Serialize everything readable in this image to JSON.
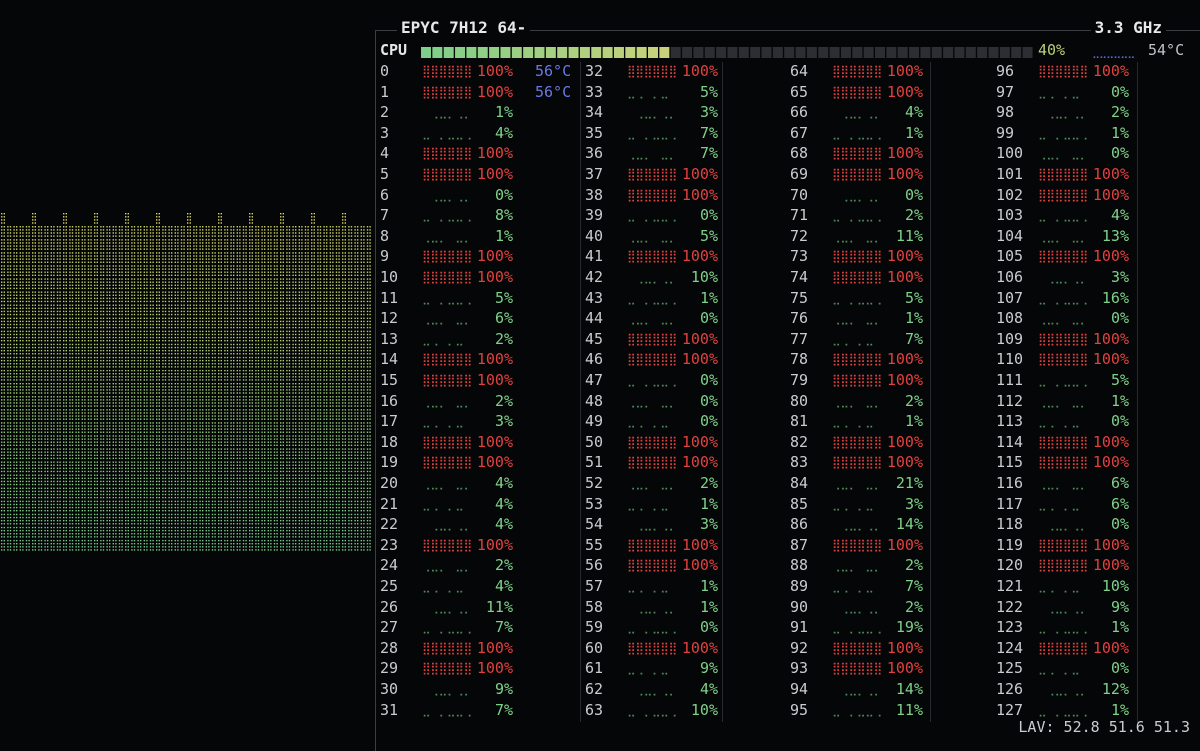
{
  "header": {
    "title": "EPYC 7H12 64-",
    "freq": "3.3 GHz"
  },
  "cpu_total": {
    "label": "CPU",
    "percent": "40%",
    "temp": "54°C",
    "usage": 0.4
  },
  "cores": [
    {
      "id": "0",
      "pct": "100%",
      "temp": "56°C"
    },
    {
      "id": "1",
      "pct": "100%",
      "temp": "56°C"
    },
    {
      "id": "2",
      "pct": "1%"
    },
    {
      "id": "3",
      "pct": "4%"
    },
    {
      "id": "4",
      "pct": "100%"
    },
    {
      "id": "5",
      "pct": "100%"
    },
    {
      "id": "6",
      "pct": "0%"
    },
    {
      "id": "7",
      "pct": "8%"
    },
    {
      "id": "8",
      "pct": "1%"
    },
    {
      "id": "9",
      "pct": "100%"
    },
    {
      "id": "10",
      "pct": "100%"
    },
    {
      "id": "11",
      "pct": "5%"
    },
    {
      "id": "12",
      "pct": "6%"
    },
    {
      "id": "13",
      "pct": "2%"
    },
    {
      "id": "14",
      "pct": "100%"
    },
    {
      "id": "15",
      "pct": "100%"
    },
    {
      "id": "16",
      "pct": "2%"
    },
    {
      "id": "17",
      "pct": "3%"
    },
    {
      "id": "18",
      "pct": "100%"
    },
    {
      "id": "19",
      "pct": "100%"
    },
    {
      "id": "20",
      "pct": "4%"
    },
    {
      "id": "21",
      "pct": "4%"
    },
    {
      "id": "22",
      "pct": "4%"
    },
    {
      "id": "23",
      "pct": "100%"
    },
    {
      "id": "24",
      "pct": "2%"
    },
    {
      "id": "25",
      "pct": "4%"
    },
    {
      "id": "26",
      "pct": "11%"
    },
    {
      "id": "27",
      "pct": "7%"
    },
    {
      "id": "28",
      "pct": "100%"
    },
    {
      "id": "29",
      "pct": "100%"
    },
    {
      "id": "30",
      "pct": "9%"
    },
    {
      "id": "31",
      "pct": "7%"
    },
    {
      "id": "32",
      "pct": "100%"
    },
    {
      "id": "33",
      "pct": "5%"
    },
    {
      "id": "34",
      "pct": "3%"
    },
    {
      "id": "35",
      "pct": "7%"
    },
    {
      "id": "36",
      "pct": "7%"
    },
    {
      "id": "37",
      "pct": "100%"
    },
    {
      "id": "38",
      "pct": "100%"
    },
    {
      "id": "39",
      "pct": "0%"
    },
    {
      "id": "40",
      "pct": "5%"
    },
    {
      "id": "41",
      "pct": "100%"
    },
    {
      "id": "42",
      "pct": "10%"
    },
    {
      "id": "43",
      "pct": "1%"
    },
    {
      "id": "44",
      "pct": "0%"
    },
    {
      "id": "45",
      "pct": "100%"
    },
    {
      "id": "46",
      "pct": "100%"
    },
    {
      "id": "47",
      "pct": "0%"
    },
    {
      "id": "48",
      "pct": "0%"
    },
    {
      "id": "49",
      "pct": "0%"
    },
    {
      "id": "50",
      "pct": "100%"
    },
    {
      "id": "51",
      "pct": "100%"
    },
    {
      "id": "52",
      "pct": "2%"
    },
    {
      "id": "53",
      "pct": "1%"
    },
    {
      "id": "54",
      "pct": "3%"
    },
    {
      "id": "55",
      "pct": "100%"
    },
    {
      "id": "56",
      "pct": "100%"
    },
    {
      "id": "57",
      "pct": "1%"
    },
    {
      "id": "58",
      "pct": "1%"
    },
    {
      "id": "59",
      "pct": "0%"
    },
    {
      "id": "60",
      "pct": "100%"
    },
    {
      "id": "61",
      "pct": "9%"
    },
    {
      "id": "62",
      "pct": "4%"
    },
    {
      "id": "63",
      "pct": "10%"
    },
    {
      "id": "64",
      "pct": "100%"
    },
    {
      "id": "65",
      "pct": "100%"
    },
    {
      "id": "66",
      "pct": "4%"
    },
    {
      "id": "67",
      "pct": "1%"
    },
    {
      "id": "68",
      "pct": "100%"
    },
    {
      "id": "69",
      "pct": "100%"
    },
    {
      "id": "70",
      "pct": "0%"
    },
    {
      "id": "71",
      "pct": "2%"
    },
    {
      "id": "72",
      "pct": "11%"
    },
    {
      "id": "73",
      "pct": "100%"
    },
    {
      "id": "74",
      "pct": "100%"
    },
    {
      "id": "75",
      "pct": "5%"
    },
    {
      "id": "76",
      "pct": "1%"
    },
    {
      "id": "77",
      "pct": "7%"
    },
    {
      "id": "78",
      "pct": "100%"
    },
    {
      "id": "79",
      "pct": "100%"
    },
    {
      "id": "80",
      "pct": "2%"
    },
    {
      "id": "81",
      "pct": "1%"
    },
    {
      "id": "82",
      "pct": "100%"
    },
    {
      "id": "83",
      "pct": "100%"
    },
    {
      "id": "84",
      "pct": "21%"
    },
    {
      "id": "85",
      "pct": "3%"
    },
    {
      "id": "86",
      "pct": "14%"
    },
    {
      "id": "87",
      "pct": "100%"
    },
    {
      "id": "88",
      "pct": "2%"
    },
    {
      "id": "89",
      "pct": "7%"
    },
    {
      "id": "90",
      "pct": "2%"
    },
    {
      "id": "91",
      "pct": "19%"
    },
    {
      "id": "92",
      "pct": "100%"
    },
    {
      "id": "93",
      "pct": "100%"
    },
    {
      "id": "94",
      "pct": "14%"
    },
    {
      "id": "95",
      "pct": "11%"
    },
    {
      "id": "96",
      "pct": "100%"
    },
    {
      "id": "97",
      "pct": "0%"
    },
    {
      "id": "98",
      "pct": "2%"
    },
    {
      "id": "99",
      "pct": "1%"
    },
    {
      "id": "100",
      "pct": "0%"
    },
    {
      "id": "101",
      "pct": "100%"
    },
    {
      "id": "102",
      "pct": "100%"
    },
    {
      "id": "103",
      "pct": "4%"
    },
    {
      "id": "104",
      "pct": "13%"
    },
    {
      "id": "105",
      "pct": "100%"
    },
    {
      "id": "106",
      "pct": "3%"
    },
    {
      "id": "107",
      "pct": "16%"
    },
    {
      "id": "108",
      "pct": "0%"
    },
    {
      "id": "109",
      "pct": "100%"
    },
    {
      "id": "110",
      "pct": "100%"
    },
    {
      "id": "111",
      "pct": "5%"
    },
    {
      "id": "112",
      "pct": "1%"
    },
    {
      "id": "113",
      "pct": "0%"
    },
    {
      "id": "114",
      "pct": "100%"
    },
    {
      "id": "115",
      "pct": "100%"
    },
    {
      "id": "116",
      "pct": "6%"
    },
    {
      "id": "117",
      "pct": "6%"
    },
    {
      "id": "118",
      "pct": "0%"
    },
    {
      "id": "119",
      "pct": "100%"
    },
    {
      "id": "120",
      "pct": "100%"
    },
    {
      "id": "121",
      "pct": "10%"
    },
    {
      "id": "122",
      "pct": "9%"
    },
    {
      "id": "123",
      "pct": "1%"
    },
    {
      "id": "124",
      "pct": "100%"
    },
    {
      "id": "125",
      "pct": "0%"
    },
    {
      "id": "126",
      "pct": "12%"
    },
    {
      "id": "127",
      "pct": "1%"
    }
  ],
  "load_avg": "LAV: 52.8 51.6 51.3",
  "colors": {
    "high": "#e0413f",
    "low": "#7fd18a",
    "temp": "#6a78e6",
    "bar_green": "#7ecf8a",
    "bar_yellow": "#c9d27a",
    "bar_empty": "#2b2e33"
  }
}
